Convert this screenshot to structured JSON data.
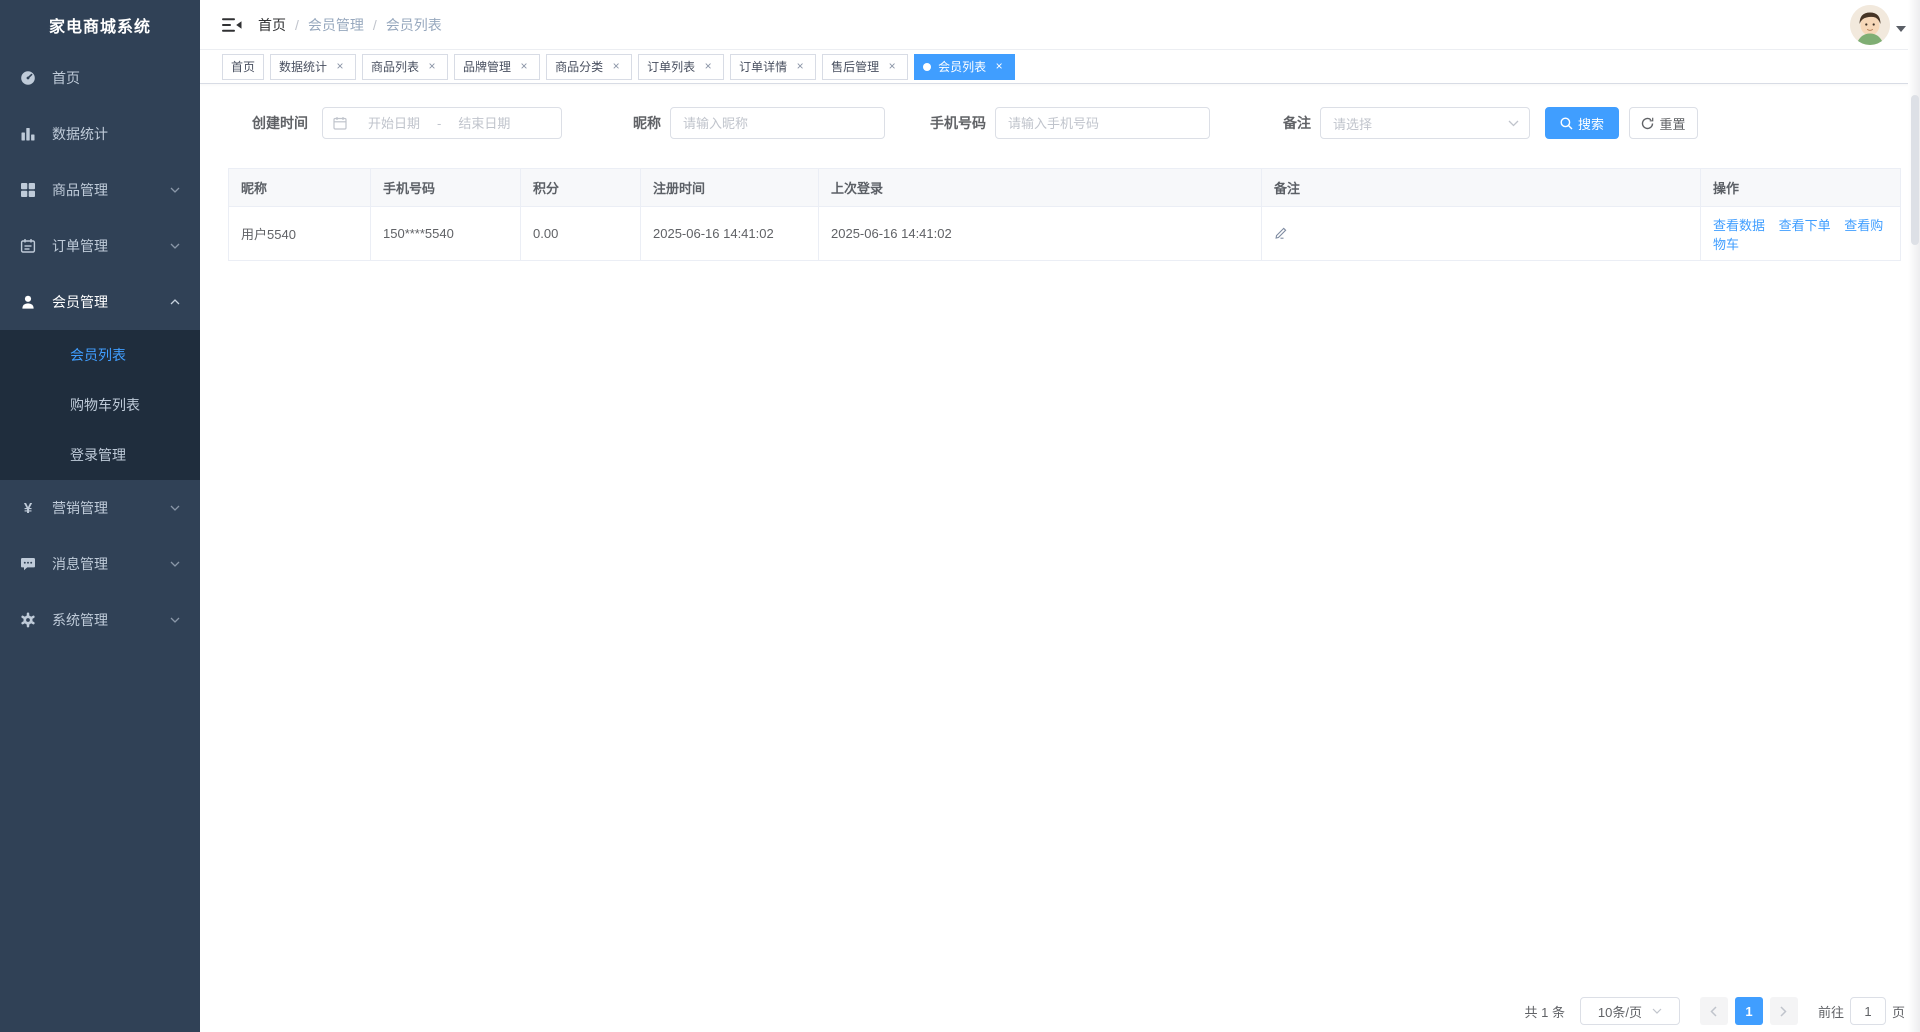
{
  "app": {
    "title": "家电商城系统"
  },
  "colors": {
    "accent": "#409eff",
    "sidebar_bg": "#304156",
    "submenu_bg": "#1f2d3d",
    "sidebar_text": "#bfcbd9"
  },
  "sidebar": {
    "items": [
      {
        "label": "首页",
        "icon": "dashboard-icon",
        "expandable": false
      },
      {
        "label": "数据统计",
        "icon": "bar-chart-icon",
        "expandable": false
      },
      {
        "label": "商品管理",
        "icon": "grid-icon",
        "expandable": true
      },
      {
        "label": "订单管理",
        "icon": "order-list-icon",
        "expandable": true
      },
      {
        "label": "会员管理",
        "icon": "user-icon",
        "expandable": true,
        "expanded": true,
        "children": [
          {
            "label": "会员列表",
            "active": true
          },
          {
            "label": "购物车列表",
            "active": false
          },
          {
            "label": "登录管理",
            "active": false
          }
        ]
      },
      {
        "label": "营销管理",
        "icon": "yen-icon",
        "expandable": true
      },
      {
        "label": "消息管理",
        "icon": "message-icon",
        "expandable": true
      },
      {
        "label": "系统管理",
        "icon": "gear-icon",
        "expandable": true
      }
    ]
  },
  "header": {
    "breadcrumb": {
      "0": "首页",
      "1": "会员管理",
      "2": "会员列表",
      "separator": "/"
    },
    "hamburger_icon": "collapse-sidebar-icon",
    "avatar_icon": "user-avatar",
    "caret_icon": "caret-down-icon"
  },
  "tabs": [
    {
      "label": "首页",
      "closable": false,
      "active": false
    },
    {
      "label": "数据统计",
      "closable": true,
      "active": false
    },
    {
      "label": "商品列表",
      "closable": true,
      "active": false
    },
    {
      "label": "品牌管理",
      "closable": true,
      "active": false
    },
    {
      "label": "商品分类",
      "closable": true,
      "active": false
    },
    {
      "label": "订单列表",
      "closable": true,
      "active": false
    },
    {
      "label": "订单详情",
      "closable": true,
      "active": false
    },
    {
      "label": "售后管理",
      "closable": true,
      "active": false
    },
    {
      "label": "会员列表",
      "closable": true,
      "active": true
    }
  ],
  "tab_close_glyph": "×",
  "filters": {
    "created_time_label": "创建时间",
    "calendar_icon": "calendar-icon",
    "start_date_placeholder": "开始日期",
    "range_separator": "-",
    "end_date_placeholder": "结束日期",
    "nickname_label": "昵称",
    "nickname_placeholder": "请输入昵称",
    "phone_label": "手机号码",
    "phone_placeholder": "请输入手机号码",
    "remark_label": "备注",
    "remark_placeholder": "请选择",
    "search_label": "搜索",
    "search_icon": "magnifier-icon",
    "reset_label": "重置",
    "reset_icon": "refresh-icon"
  },
  "table": {
    "columns": [
      "昵称",
      "手机号码",
      "积分",
      "注册时间",
      "上次登录",
      "备注",
      "操作"
    ],
    "rows": [
      {
        "nickname": "用户5540",
        "phone": "150****5540",
        "points": "0.00",
        "register_time": "2025-06-16 14:41:02",
        "last_login": "2025-06-16 14:41:02",
        "remark_icon": "edit-pencil-icon",
        "actions": [
          "查看数据",
          "查看下单",
          "查看购物车"
        ]
      }
    ]
  },
  "pagination": {
    "total_text": "共 1 条",
    "page_size": "10条/页",
    "prev_icon": "chevron-left-icon",
    "current_page": "1",
    "next_icon": "chevron-right-icon",
    "goto_label": "前往",
    "goto_value": "1",
    "page_suffix": "页"
  }
}
